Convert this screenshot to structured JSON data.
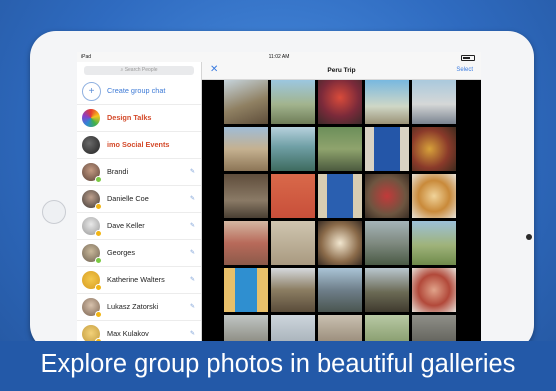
{
  "status": {
    "device": "iPad",
    "time": "11:02 AM"
  },
  "sidebar": {
    "search_placeholder": "Search People",
    "create_label": "Create group chat",
    "groups": [
      {
        "name": "Design Talks"
      },
      {
        "name": "imo Social Events"
      }
    ],
    "contacts": [
      {
        "name": "Brandi"
      },
      {
        "name": "Danielle Coe"
      },
      {
        "name": "Dave Keller"
      },
      {
        "name": "Georges"
      },
      {
        "name": "Katherine Walters"
      },
      {
        "name": "Lukasz Zatorski"
      },
      {
        "name": "Max Kulakov"
      }
    ]
  },
  "gallery": {
    "title": "Peru Trip",
    "select_label": "Select",
    "close_icon": "close-icon"
  },
  "banner": {
    "text": "Explore group photos in beautiful galleries"
  },
  "colors": {
    "background": "#2f6bc0",
    "accent": "#3a7be0",
    "group_name": "#d44a2a"
  }
}
